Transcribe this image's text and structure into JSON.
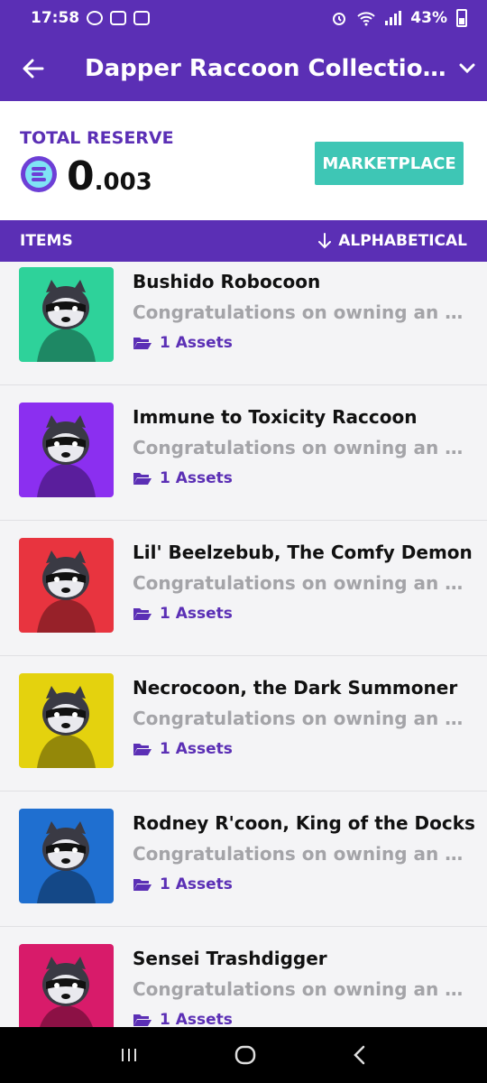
{
  "status_bar": {
    "time": "17:58",
    "battery": "43%"
  },
  "header": {
    "title": "Dapper Raccoon Collection (…"
  },
  "reserve": {
    "label": "TOTAL RESERVE",
    "value_int": "0",
    "value_dec": ".003",
    "marketplace_label": "MARKETPLACE"
  },
  "items_bar": {
    "label": "ITEMS",
    "sort_label": "ALPHABETICAL"
  },
  "items": [
    {
      "name": "Bushido Robocoon",
      "desc": "Congratulations on owning an e…",
      "assets": "1 Assets",
      "bg": "#2ed29a"
    },
    {
      "name": "Immune to Toxicity Raccoon",
      "desc": "Congratulations on owning an e…",
      "assets": "1 Assets",
      "bg": "#8b2ff0"
    },
    {
      "name": "Lil' Beelzebub, The Comfy Demon",
      "desc": "Congratulations on owning an e…",
      "assets": "1 Assets",
      "bg": "#e8343f"
    },
    {
      "name": "Necrocoon, the Dark Summoner",
      "desc": "Congratulations on owning an e…",
      "assets": "1 Assets",
      "bg": "#e4d20e"
    },
    {
      "name": "Rodney R'coon, King of the Docks",
      "desc": "Congratulations on owning an e…",
      "assets": "1 Assets",
      "bg": "#1f6fd0"
    },
    {
      "name": "Sensei Trashdigger",
      "desc": "Congratulations on owning an e…",
      "assets": "1 Assets",
      "bg": "#d81b6a"
    }
  ],
  "colors": {
    "primary": "#5b2fb5",
    "accent": "#3ec6b5"
  }
}
